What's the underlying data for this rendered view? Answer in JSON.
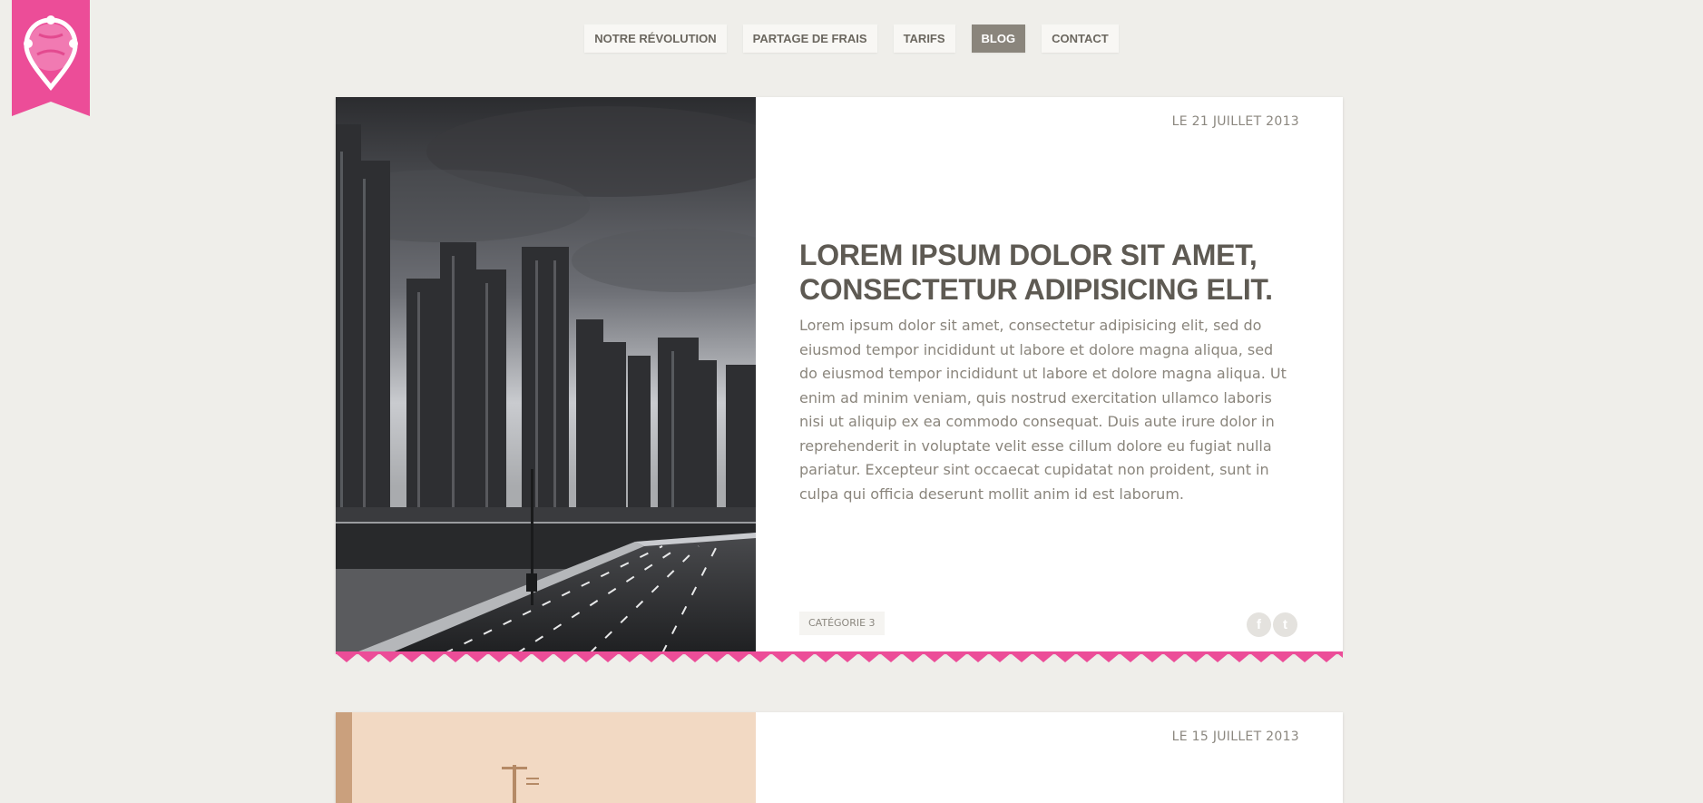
{
  "nav": {
    "items": [
      {
        "label": "NOTRE RÉVOLUTION",
        "active": false
      },
      {
        "label": "PARTAGE DE FRAIS",
        "active": false
      },
      {
        "label": "TARIFS",
        "active": false
      },
      {
        "label": "BLOG",
        "active": true
      },
      {
        "label": "CONTACT",
        "active": false
      }
    ]
  },
  "colors": {
    "accent_pink": "#ec4d98",
    "text_dark": "#5e5a53",
    "text_muted": "#8a857c",
    "background": "#efeeea"
  },
  "icons": {
    "logo": "map-pin-logo-icon",
    "facebook": "facebook-icon",
    "twitter": "twitter-icon"
  },
  "posts": [
    {
      "date": "LE 21 JUILLET 2013",
      "title_line1": "LOREM IPSUM DOLOR SIT AMET,",
      "title_line2": "CONSECTETUR ADIPISICING ELIT.",
      "body": "Lorem ipsum dolor sit amet, consectetur adipisicing elit, sed do eiusmod tempor incididunt ut labore et dolore magna aliqua, sed do eiusmod tempor incididunt ut labore et dolore magna aliqua. Ut enim ad minim veniam, quis nostrud exercitation ullamco laboris nisi ut aliquip ex ea commodo consequat. Duis aute irure dolor in reprehenderit in voluptate velit esse cillum dolore eu fugiat nulla pariatur. Excepteur sint occaecat cupidatat non proident, sunt in culpa qui officia deserunt mollit anim id est laborum.",
      "category": "CATÉGORIE 3",
      "facebook_glyph": "f",
      "twitter_glyph": "t"
    },
    {
      "date": "LE 15 JUILLET 2013"
    }
  ]
}
